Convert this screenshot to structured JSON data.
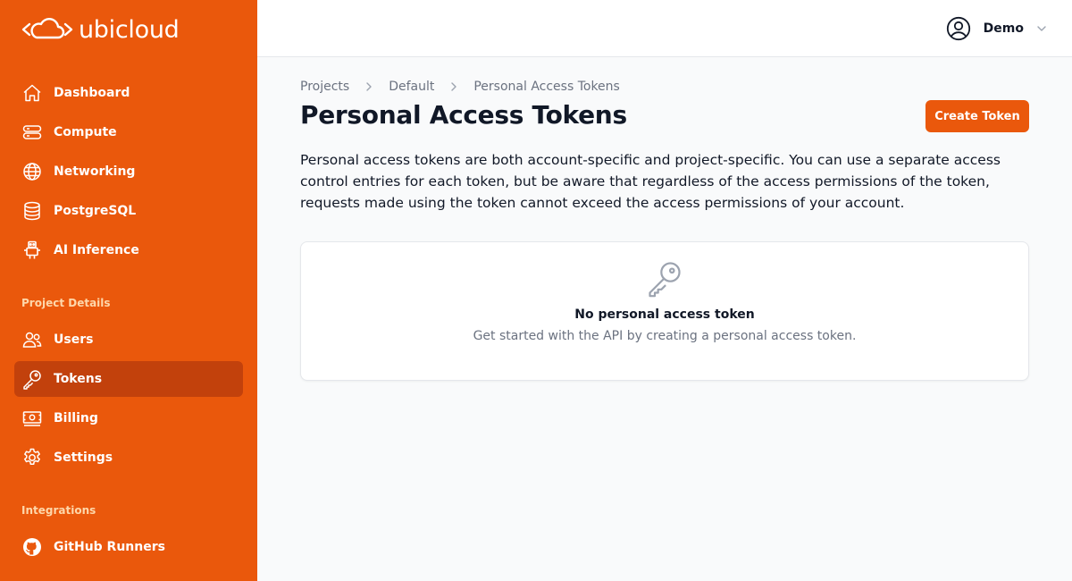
{
  "brand": {
    "name": "ubicloud"
  },
  "sidebar": {
    "main_items": [
      {
        "label": "Dashboard",
        "icon": "home-icon"
      },
      {
        "label": "Compute",
        "icon": "server-icon"
      },
      {
        "label": "Networking",
        "icon": "globe-icon"
      },
      {
        "label": "PostgreSQL",
        "icon": "database-icon"
      },
      {
        "label": "AI Inference",
        "icon": "robot-icon"
      }
    ],
    "project_section_label": "Project Details",
    "project_items": [
      {
        "label": "Users",
        "icon": "users-icon"
      },
      {
        "label": "Tokens",
        "icon": "key-icon",
        "active": true
      },
      {
        "label": "Billing",
        "icon": "banknotes-icon"
      },
      {
        "label": "Settings",
        "icon": "gear-icon"
      }
    ],
    "integrations_section_label": "Integrations",
    "integration_items": [
      {
        "label": "GitHub Runners",
        "icon": "github-icon"
      }
    ]
  },
  "header": {
    "user_name": "Demo"
  },
  "breadcrumb": [
    "Projects",
    "Default",
    "Personal Access Tokens"
  ],
  "page": {
    "title": "Personal Access Tokens",
    "create_button": "Create Token",
    "description": "Personal access tokens are both account-specific and project-specific. You can use a separate access control entries for each token, but be aware that regardless of the access permissions of the token, requests made using the token cannot exceed the access permissions of your account."
  },
  "empty_state": {
    "title": "No personal access token",
    "subtitle": "Get started with the API by creating a personal access token."
  },
  "colors": {
    "brand": "#ea580c",
    "active_item": "#c2410c",
    "background": "#f9fafb"
  }
}
